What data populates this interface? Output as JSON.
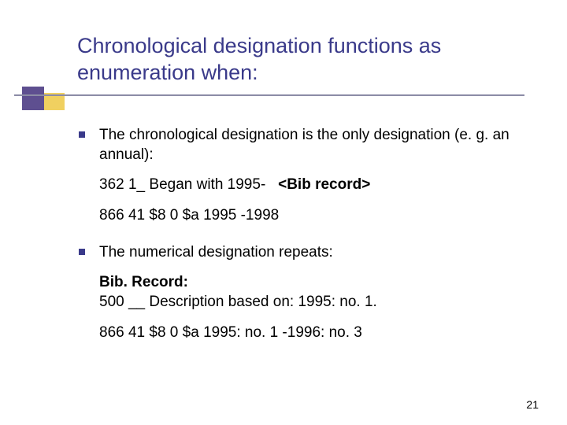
{
  "title": "Chronological designation functions as enumeration when:",
  "bullets": [
    {
      "text": "The chronological designation is the only designation (e. g. an annual):",
      "lines": [
        {
          "prefix": "362 1_ Began with 1995-   ",
          "bold": "<Bib record>"
        },
        {
          "text": "866 41 $8 0 $a 1995 -1998"
        }
      ]
    },
    {
      "text": "The numerical designation repeats:",
      "lines": [
        {
          "bold": "Bib. Record:"
        },
        {
          "text": "500 __  Description based on: 1995: no. 1."
        },
        {
          "text": "866 41 $8 0 $a 1995: no. 1 -1996: no. 3"
        }
      ]
    }
  ],
  "page_number": "21"
}
